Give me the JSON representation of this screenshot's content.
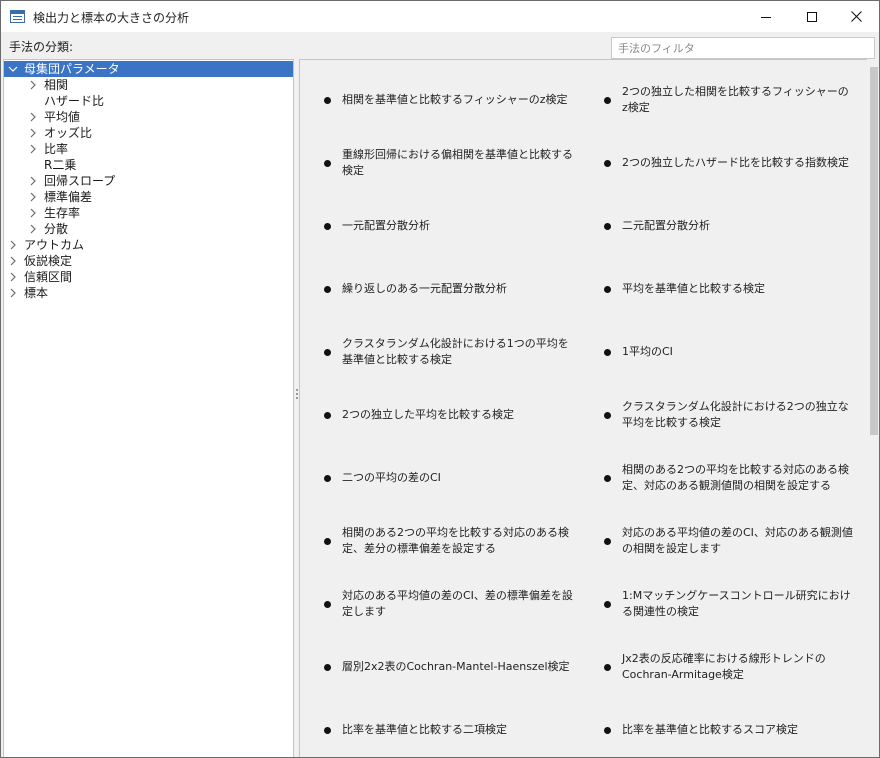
{
  "window": {
    "title": "検出力と標本の大きさの分析"
  },
  "filter": {
    "label": "手法の分類:",
    "placeholder": "手法のフィルタ"
  },
  "tree": [
    {
      "label": "母集団パラメータ",
      "expanded": true,
      "selected": true,
      "level": 0,
      "has_children": true
    },
    {
      "label": "相関",
      "level": 1,
      "has_children": true
    },
    {
      "label": "ハザード比",
      "level": 1,
      "has_children": false
    },
    {
      "label": "平均値",
      "level": 1,
      "has_children": true
    },
    {
      "label": "オッズ比",
      "level": 1,
      "has_children": true
    },
    {
      "label": "比率",
      "level": 1,
      "has_children": true
    },
    {
      "label": "R二乗",
      "level": 1,
      "has_children": false
    },
    {
      "label": "回帰スロープ",
      "level": 1,
      "has_children": true
    },
    {
      "label": "標準偏差",
      "level": 1,
      "has_children": true
    },
    {
      "label": "生存率",
      "level": 1,
      "has_children": true
    },
    {
      "label": "分散",
      "level": 1,
      "has_children": true
    },
    {
      "label": "アウトカム",
      "level": 0,
      "has_children": true
    },
    {
      "label": "仮説検定",
      "level": 0,
      "has_children": true
    },
    {
      "label": "信頼区間",
      "level": 0,
      "has_children": true
    },
    {
      "label": "標本",
      "level": 0,
      "has_children": true
    }
  ],
  "methods": [
    "相関を基準値と比較するフィッシャーのz検定",
    "2つの独立した相関を比較するフィッシャーのz検定",
    "重線形回帰における偏相関を基準値と比較する検定",
    "2つの独立したハザード比を比較する指数検定",
    "一元配置分散分析",
    "二元配置分散分析",
    "繰り返しのある一元配置分散分析",
    "平均を基準値と比較する検定",
    "クラスタランダム化設計における1つの平均を基準値と比較する検定",
    "1平均のCI",
    "2つの独立した平均を比較する検定",
    "クラスタランダム化設計における2つの独立な平均を比較する検定",
    "二つの平均の差のCI",
    "相関のある2つの平均を比較する対応のある検定、対応のある観測値間の相関を設定する",
    "相関のある2つの平均を比較する対応のある検定、差分の標準偏差を設定する",
    "対応のある平均値の差のCI、対応のある観測値の相関を設定します",
    "対応のある平均値の差のCI、差の標準偏差を設定します",
    "1:Mマッチングケースコントロール研究における関連性の検定",
    "層別2x2表のCochran-Mantel-Haenszel検定",
    "Jx2表の反応確率における線形トレンドのCochran-Armitage検定",
    "比率を基準値と比較する二項検定",
    "比率を基準値と比較するスコア検定"
  ],
  "colors": {
    "selection": "#3b74c4",
    "pane_bg": "#f0f0f0",
    "tree_bg": "#ffffff"
  }
}
